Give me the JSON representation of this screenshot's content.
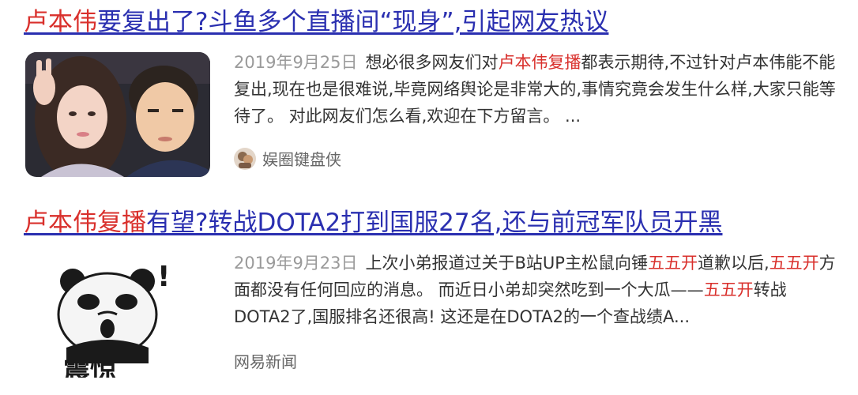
{
  "results": [
    {
      "title_highlight": "卢本伟",
      "title_rest": "要复出了?斗鱼多个直播间“现身”,引起网友热议",
      "date": "2019年9月25日",
      "snippet_part1": "想必很多网友们对",
      "snippet_highlight": "卢本伟复播",
      "snippet_part2": "都表示期待,不过针对卢本伟能不能复出,现在也是很难说,毕竟网络舆论是非常大的,事情究竟会发生什么样,大家只能等待了。 对此网友们怎么看,欢迎在下方留言。 ...",
      "source": "娱圈键盘侠",
      "thumbnail_icon": "couple-photo-icon",
      "source_icon": "author-avatar-icon"
    },
    {
      "title_highlight": "卢本伟复播",
      "title_rest": "有望?转战DOTA2打到国服27名,还与前冠军队员开黑",
      "date": "2019年9月23日",
      "snippet_part1": "上次小弟报道过关于B站UP主松鼠向锤",
      "snippet_hl1": "五五开",
      "snippet_part2": "道歉以后,",
      "snippet_hl2": "五五开",
      "snippet_part3": "方面都没有任何回应的消息。 而近日小弟却突然吃到一个大瓜——",
      "snippet_hl3": "五五开",
      "snippet_part4": "转战DOTA2了,国服排名还很高! 这还是在DOTA2的一个查战绩A...",
      "source": "网易新闻",
      "thumbnail_caption": "震惊",
      "thumbnail_mark": "!",
      "thumbnail_icon": "panda-meme-icon"
    }
  ],
  "colors": {
    "title_link": "#2a2fb0",
    "highlight": "#d9302c",
    "date": "#9a9a9a",
    "source": "#666666"
  }
}
